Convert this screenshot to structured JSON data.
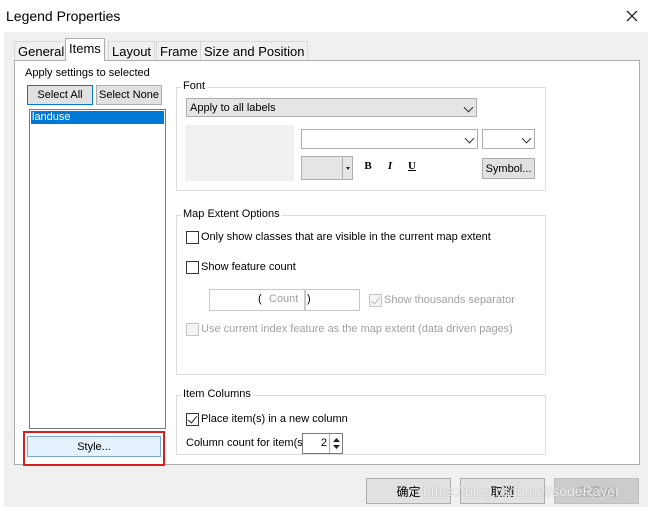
{
  "window": {
    "title": "Legend Properties"
  },
  "tabs": [
    {
      "label": "General"
    },
    {
      "label": "Items"
    },
    {
      "label": "Layout"
    },
    {
      "label": "Frame"
    },
    {
      "label": "Size and Position"
    }
  ],
  "left": {
    "apply_label": "Apply settings to selected",
    "select_all": "Select All",
    "select_none": "Select None",
    "items": [
      "landuse"
    ],
    "style_button": "Style..."
  },
  "font": {
    "group_label": "Font",
    "apply_combo": "Apply to all labels",
    "bold": "B",
    "italic": "I",
    "underline": "U",
    "symbol_button": "Symbol..."
  },
  "map_extent": {
    "group_label": "Map Extent Options",
    "only_visible": "Only show classes that are visible in the current map extent",
    "show_count": "Show feature count",
    "count_open": "(",
    "count_label": "Count",
    "count_close": ")",
    "thousands": "Show thousands separator",
    "index_feature": "Use current index feature as the map extent (data driven pages)"
  },
  "item_columns": {
    "group_label": "Item Columns",
    "new_column": "Place item(s) in a new column",
    "column_count_label": "Column count for item(s)",
    "column_count": "2"
  },
  "footer": {
    "ok": "确定",
    "cancel": "取消",
    "apply": "应用(A)"
  },
  "watermark": "https://blog.csdn.net/sodeRayer",
  "colors": {
    "accent": "#0078d7",
    "highlight": "#d81e1e"
  }
}
